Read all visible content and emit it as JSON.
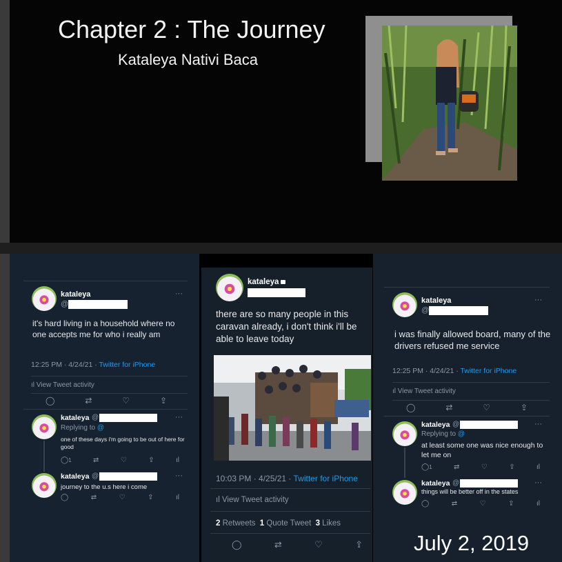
{
  "slide": {
    "title": "Chapter 2 : The Journey",
    "subtitle": "Kataleya Nativi Baca"
  },
  "tweet_left": {
    "name": "kataleya",
    "handle_prefix": "@",
    "text": "it's hard living in a household where no one accepts me for who i really am",
    "time": "12:25 PM · 4/24/21 · ",
    "source": "Twitter for iPhone",
    "activity": "View Tweet activity",
    "replies": [
      {
        "name": "kataleya",
        "handle_prefix": "@",
        "replying_label": "Replying to ",
        "replying_handle": "@",
        "text": "one of these days i'm going to be out of here for good",
        "reply_count": "1"
      },
      {
        "name": "kataleya",
        "handle_prefix": "@",
        "text": "journey to the u.s here i come"
      }
    ]
  },
  "tweet_middle": {
    "name": "kataleya",
    "text": "there are so many people in this caravan already, i don't think i'll be able to leave today",
    "time": "10:03 PM · 4/25/21 · ",
    "source": "Twitter for iPhone",
    "activity": "View Tweet activity",
    "retweets_count": "2",
    "retweets_label": "Retweets",
    "quote_count": "1",
    "quote_label": "Quote Tweet",
    "likes_count": "3",
    "likes_label": "Likes"
  },
  "tweet_right": {
    "name": "kataleya",
    "handle_prefix": "@",
    "text": "i was finally allowed board, many of the drivers refused me service",
    "time": "12:25 PM · 4/24/21 · ",
    "source": "Twitter for iPhone",
    "activity": "View Tweet activity",
    "replies": [
      {
        "name": "kataleya",
        "handle_prefix": "@",
        "replying_label": "Replying to ",
        "replying_handle": "@",
        "text": "at least some one was nice enough to let me on",
        "reply_count": "1"
      },
      {
        "name": "kataleya",
        "handle_prefix": "@",
        "text": "things will be better off in the states"
      }
    ]
  },
  "date_caption": "July 2, 2019",
  "colors": {
    "link": "#1d9bf0",
    "panel_bg": "#15202b",
    "muted": "#8b98a5"
  }
}
